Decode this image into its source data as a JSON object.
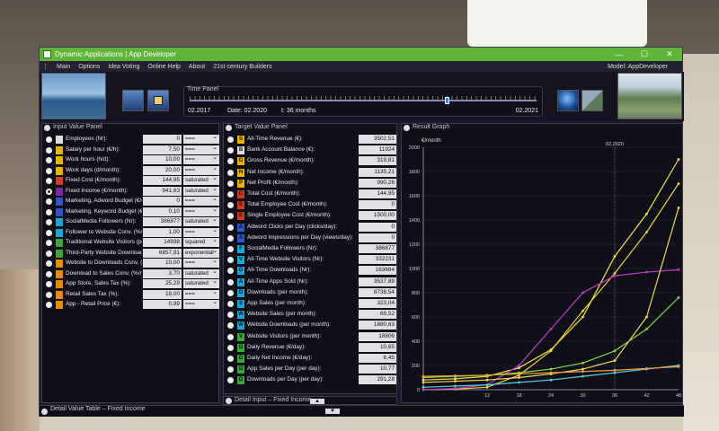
{
  "window": {
    "title": "Dynamic Applications | App Developer"
  },
  "menu": {
    "items": [
      "Main",
      "Options",
      "Idea Voting",
      "Online Help",
      "About",
      "21st century Builders"
    ],
    "model": "Model:  AppDeveloper"
  },
  "time_panel": {
    "title": "Time Panel",
    "start": "02.2017",
    "end": "02.2021",
    "date": "Date:  02.2020",
    "t": "t: 36  months"
  },
  "input_panel": {
    "title": "Input Value Panel",
    "rows": [
      {
        "label": "Employees (Nr):",
        "value": "0",
        "mode": "===",
        "color": "#ddd"
      },
      {
        "label": "Salary per hour (€/h):",
        "value": "7,50",
        "mode": "===",
        "color": "#e8b400"
      },
      {
        "label": "Work hours (h/d):",
        "value": "10,00",
        "mode": "===",
        "color": "#e8b400"
      },
      {
        "label": "Work days (d/month):",
        "value": "20,00",
        "mode": "===",
        "color": "#e8b400"
      },
      {
        "label": "Fixed Cost (€/month):",
        "value": "144,95",
        "mode": "saturated",
        "color": "#d03a1e"
      },
      {
        "label": "Fixed Income (€/month):",
        "value": "941,63",
        "mode": "saturated",
        "color": "#7b28a0",
        "selected": true
      },
      {
        "label": "Marketing, Adword Budget (€/day):",
        "value": "0",
        "mode": "===",
        "color": "#2e54c8"
      },
      {
        "label": "Marketing, Keyword Budget (€/click):",
        "value": "0,10",
        "mode": "===",
        "color": "#2e54c8"
      },
      {
        "label": "SocialMedia Followers (Nr):",
        "value": "386877",
        "mode": "saturated",
        "color": "#1ba6d6"
      },
      {
        "label": "Follower to Website Conv. (%/month):",
        "value": "1,00",
        "mode": "===",
        "color": "#1ba6d6"
      },
      {
        "label": "Traditional Website Visitors (per month):",
        "value": "14938",
        "mode": "squared",
        "color": "#3aa63a"
      },
      {
        "label": "Third-Party Website Downloads (per month):",
        "value": "6857,91",
        "mode": "exponential",
        "color": "#3aa63a"
      },
      {
        "label": "Website to Downloads Conv. (%/month):",
        "value": "10,00",
        "mode": "===",
        "color": "#e88a00"
      },
      {
        "label": "Download to Sales Conv. (%/month):",
        "value": "3,70",
        "mode": "saturated",
        "color": "#e88a00"
      },
      {
        "label": "App Store, Sales Tax (%):",
        "value": "25,29",
        "mode": "saturated",
        "color": "#e88a00"
      },
      {
        "label": "Retail Sales Tax (%):",
        "value": "19,00",
        "mode": "===",
        "color": "#e88a00"
      },
      {
        "label": "App - Retail Price (€):",
        "value": "0,99",
        "mode": "===",
        "color": "#e88a00"
      }
    ]
  },
  "target_panel": {
    "title": "Target Value Panel",
    "rows": [
      {
        "label": "All-Time Revenue (€):",
        "value": "3502,51",
        "badge": "S",
        "color": "#e8b400"
      },
      {
        "label": "Bank Account Balance (€):",
        "value": "11924",
        "badge": "B",
        "color": "#ddd"
      },
      {
        "label": "Gross Revenue (€/month):",
        "value": "319,81",
        "badge": "G",
        "color": "#e8b400"
      },
      {
        "label": "Net Income (€/month):",
        "value": "1135,21",
        "badge": "N",
        "color": "#e8b400"
      },
      {
        "label": "Net Profit (€/month):",
        "value": "990,26",
        "badge": "P",
        "color": "#e8b400"
      },
      {
        "label": "Total Cost (€/month):",
        "value": "144,95",
        "badge": "C",
        "color": "#d03a1e"
      },
      {
        "label": "Total Employee Cost (€/month):",
        "value": "0",
        "badge": "E",
        "color": "#d03a1e"
      },
      {
        "label": "Single Employee Cost (€/month):",
        "value": "1500,00",
        "badge": "E",
        "color": "#d03a1e"
      },
      {
        "label": "Adword Clicks per Day (clicks/day):",
        "value": "0",
        "badge": "A",
        "color": "#2e54c8"
      },
      {
        "label": "Adword Impressions per Day (views/day):",
        "value": "0",
        "badge": "A",
        "color": "#2e54c8"
      },
      {
        "label": "SocialMedia Followers (Nr):",
        "value": "386877",
        "badge": "F",
        "color": "#1ba6d6"
      },
      {
        "label": "All-Time Website Visitors (Nr):",
        "value": "332231",
        "badge": "V",
        "color": "#1ba6d6"
      },
      {
        "label": "All-Time Downloads (Nr):",
        "value": "163684",
        "badge": "D",
        "color": "#1ba6d6"
      },
      {
        "label": "All-Time Apps Sold (Nr):",
        "value": "3537,89",
        "badge": "A",
        "color": "#1ba6d6"
      },
      {
        "label": "Downloads (per month):",
        "value": "8738,54",
        "badge": "D",
        "color": "#1ba6d6"
      },
      {
        "label": "App Sales (per month):",
        "value": "323,04",
        "badge": "S",
        "color": "#1ba6d6"
      },
      {
        "label": "Website Sales (per month):",
        "value": "69,52",
        "badge": "W",
        "color": "#1ba6d6"
      },
      {
        "label": "Website Downloads (per month):",
        "value": "1880,63",
        "badge": "W",
        "color": "#1ba6d6"
      },
      {
        "label": "Website Visitors (per month):",
        "value": "18806",
        "badge": "V",
        "color": "#3aa63a"
      },
      {
        "label": "Daily Revenue (€/day):",
        "value": "10,65",
        "badge": "D",
        "color": "#3aa63a"
      },
      {
        "label": "Daily Net Income (€/day):",
        "value": "6,45",
        "badge": "D",
        "color": "#3aa63a"
      },
      {
        "label": "App Sales per Day (per day):",
        "value": "10,77",
        "badge": "D",
        "color": "#3aa63a"
      },
      {
        "label": "Downloads per Day (per day):",
        "value": "291,28",
        "badge": "D",
        "color": "#3aa63a"
      }
    ]
  },
  "graph": {
    "title": "Result Graph",
    "y_unit": "€/month",
    "marker_label": "02.2020"
  },
  "chart_data": {
    "type": "line",
    "ylim": [
      0,
      2000
    ],
    "xlim": [
      0,
      48
    ],
    "yticks": [
      "0",
      "200",
      "400",
      "600",
      "800",
      "1000",
      "1200",
      "1400",
      "1600",
      "1800",
      "2000"
    ],
    "xticks": [
      "12",
      "18",
      "24",
      "30",
      "36",
      "42",
      "48"
    ],
    "marker_x": 36,
    "series": [
      {
        "color": "#f2e24a",
        "x": [
          0,
          6,
          12,
          18,
          24,
          30,
          36,
          42,
          48
        ],
        "values": [
          80,
          90,
          110,
          180,
          330,
          600,
          1100,
          1450,
          1900
        ]
      },
      {
        "color": "#e8d24a",
        "x": [
          0,
          6,
          12,
          18,
          24,
          30,
          36,
          42,
          48
        ],
        "values": [
          0,
          5,
          20,
          120,
          320,
          650,
          960,
          1300,
          1700
        ]
      },
      {
        "color": "#c23cc8",
        "x": [
          0,
          6,
          12,
          18,
          24,
          30,
          36,
          42,
          48
        ],
        "values": [
          0,
          10,
          40,
          200,
          500,
          800,
          940,
          970,
          990
        ]
      },
      {
        "color": "#f0d860",
        "x": [
          0,
          6,
          12,
          18,
          24,
          30,
          36,
          42,
          48
        ],
        "values": [
          60,
          70,
          80,
          100,
          130,
          170,
          240,
          600,
          1500
        ]
      },
      {
        "color": "#8cd44a",
        "x": [
          0,
          6,
          12,
          18,
          24,
          30,
          36,
          42,
          48
        ],
        "values": [
          100,
          110,
          120,
          140,
          170,
          220,
          320,
          500,
          760
        ]
      },
      {
        "color": "#5ad0e0",
        "x": [
          0,
          6,
          12,
          18,
          24,
          30,
          36,
          42,
          48
        ],
        "values": [
          20,
          30,
          40,
          60,
          80,
          110,
          140,
          170,
          200
        ]
      },
      {
        "color": "#f0a040",
        "x": [
          0,
          6,
          12,
          18,
          24,
          30,
          36,
          42,
          48
        ],
        "values": [
          110,
          115,
          120,
          130,
          140,
          150,
          160,
          175,
          190
        ]
      }
    ]
  },
  "detail_input": {
    "title": "Detail Input – Fixed Income"
  },
  "detail_table": {
    "title": "Detail Value Table – Fixed Income"
  }
}
